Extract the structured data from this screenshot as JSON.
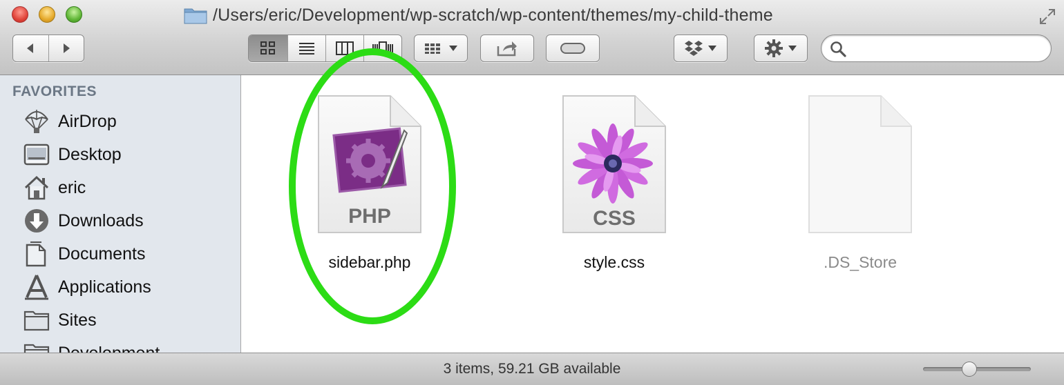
{
  "window": {
    "path": "/Users/eric/Development/wp-scratch/wp-content/themes/my-child-theme"
  },
  "toolbar": {
    "search_placeholder": ""
  },
  "sidebar": {
    "header": "FAVORITES",
    "items": [
      {
        "label": "AirDrop",
        "icon": "airdrop-icon"
      },
      {
        "label": "Desktop",
        "icon": "desktop-icon"
      },
      {
        "label": "eric",
        "icon": "home-icon"
      },
      {
        "label": "Downloads",
        "icon": "downloads-icon"
      },
      {
        "label": "Documents",
        "icon": "documents-icon"
      },
      {
        "label": "Applications",
        "icon": "applications-icon"
      },
      {
        "label": "Sites",
        "icon": "folder-icon"
      },
      {
        "label": "Development",
        "icon": "folder-icon"
      }
    ]
  },
  "files": [
    {
      "name": "sidebar.php",
      "badge": "PHP",
      "icon": "php-file-icon"
    },
    {
      "name": "style.css",
      "badge": "CSS",
      "icon": "css-file-icon"
    },
    {
      "name": ".DS_Store",
      "badge": "",
      "icon": "blank-file-icon"
    }
  ],
  "status": {
    "text": "3 items, 59.21 GB available",
    "icon_size_level": 0.43
  },
  "colors": {
    "highlight": "#2cdc15",
    "sidebar_bg": "#e2e7ed",
    "php_purple": "#7b2d86"
  }
}
